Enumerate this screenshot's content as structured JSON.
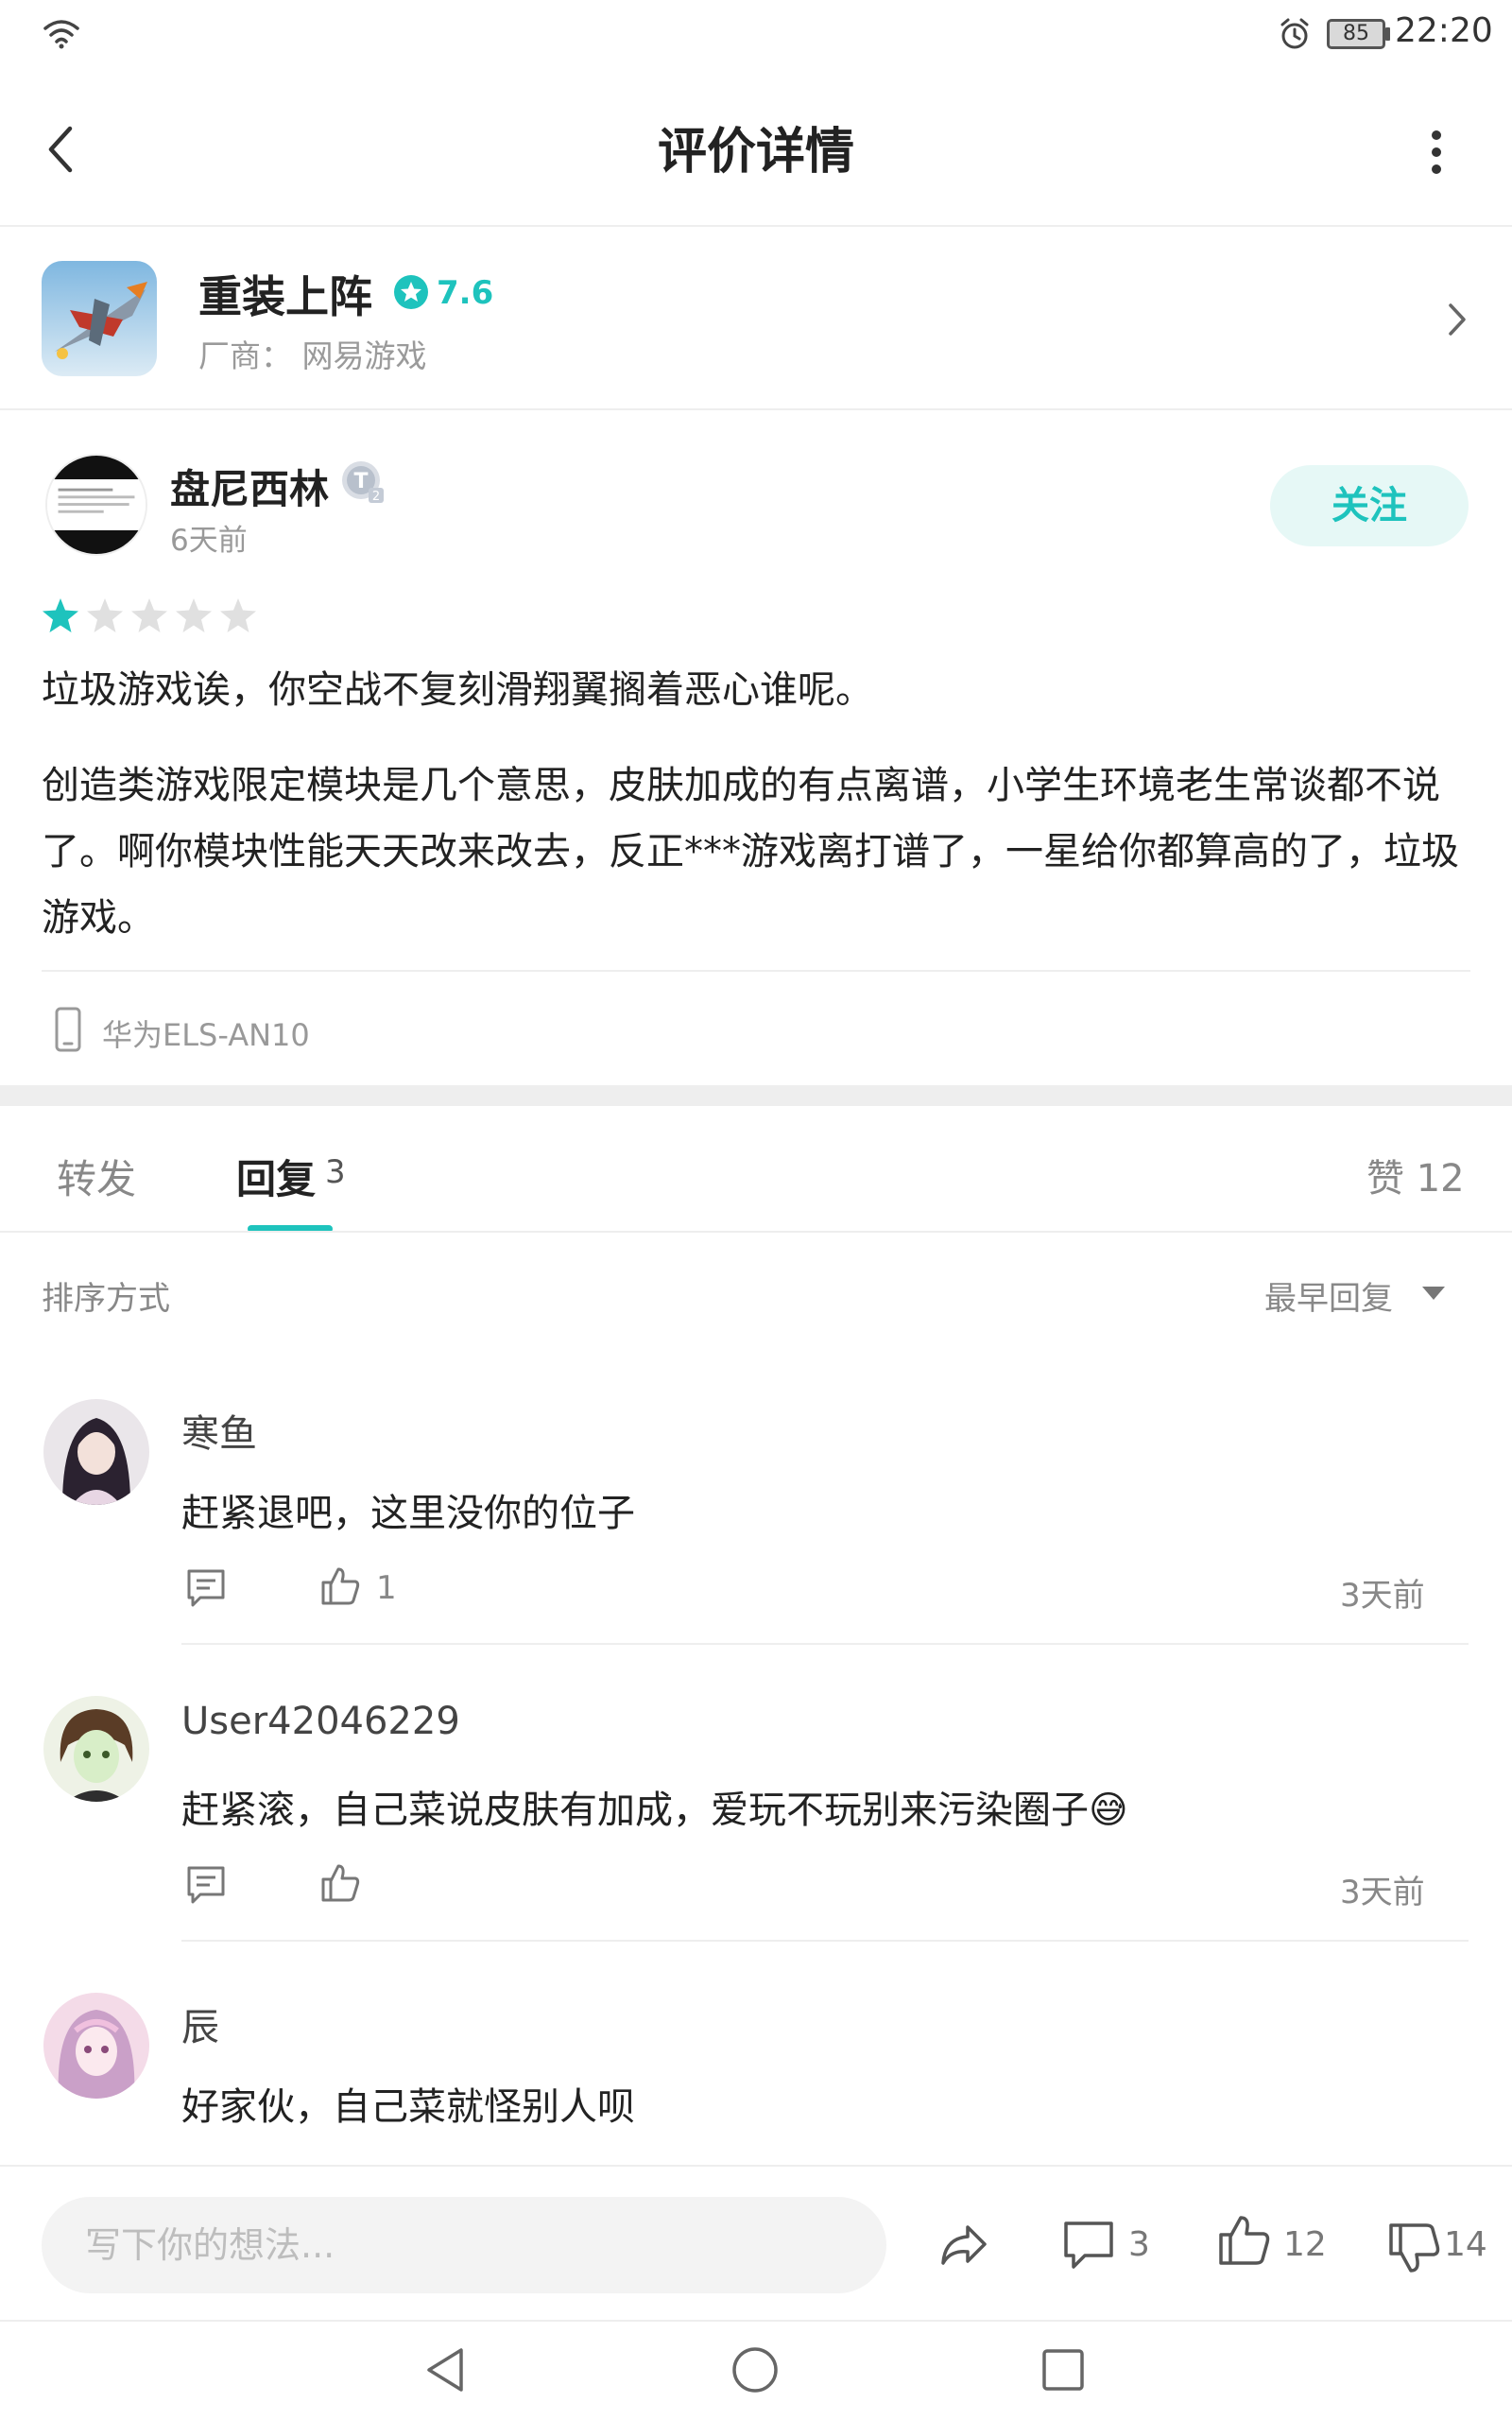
{
  "status_bar": {
    "battery": "85",
    "time": "22:20",
    "icons": [
      "wifi-icon",
      "alarm-icon",
      "battery-icon"
    ]
  },
  "header": {
    "title": "评价详情",
    "icons": [
      "back-icon",
      "more-icon"
    ]
  },
  "game": {
    "name": "重装上阵",
    "score": "7.6",
    "vendor": "厂商： 网易游戏",
    "accent_color": "#1ec3bd"
  },
  "review": {
    "author": "盘尼西林",
    "time": "6天前",
    "follow_label": "关注",
    "stars": 1,
    "stars_max": 5,
    "line1": "垃圾游戏诶，你空战不复刻滑翔翼搁着恶心谁呢。",
    "paragraph2": "创造类游戏限定模块是几个意思，皮肤加成的有点离谱，小学生环境老生常谈都不说了。啊你模块性能天天改来改去，反正***游戏离打谱了，一星给你都算高的了，垃圾游戏。",
    "device": "华为ELS-AN10"
  },
  "tabs": {
    "forward": "转发",
    "reply": "回复",
    "reply_count": "3",
    "likes": "赞 12"
  },
  "sort": {
    "label": "排序方式",
    "value": "最早回复"
  },
  "comments": [
    {
      "name": "寒鱼",
      "text": "赶紧退吧，这里没你的位子",
      "likes": "1",
      "time": "3天前"
    },
    {
      "name": "User42046229",
      "text": "赶紧滚，自己菜说皮肤有加成，爱玩不玩别来污染圈子😅",
      "likes": "",
      "time": "3天前"
    },
    {
      "name": "辰",
      "text": "好家伙，自己菜就怪别人呗"
    }
  ],
  "bottom_bar": {
    "input_placeholder": "写下你的想法...",
    "comment_count": "3",
    "like_count": "12",
    "dislike_count": "14"
  }
}
